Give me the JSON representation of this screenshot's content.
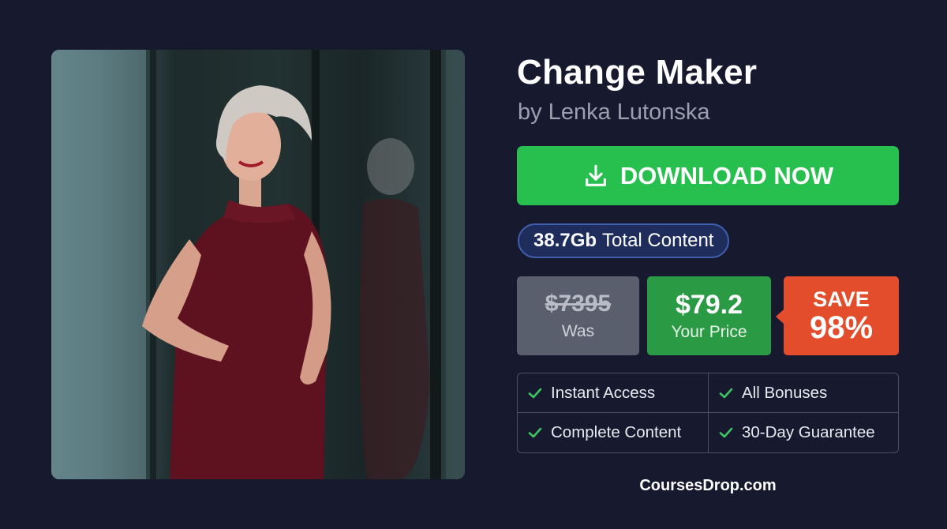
{
  "product": {
    "title": "Change Maker",
    "author": "by Lenka Lutonska"
  },
  "download": {
    "label": "DOWNLOAD NOW",
    "icon": "download-icon"
  },
  "content_size": {
    "value": "38.7Gb",
    "label": "Total Content"
  },
  "pricing": {
    "old_price": "$7395",
    "old_label": "Was",
    "price": "$79.2",
    "price_label": "Your Price",
    "save_label": "SAVE",
    "save_percent": "98%"
  },
  "features": [
    {
      "label": "Instant Access",
      "icon": "check-icon"
    },
    {
      "label": "All Bonuses",
      "icon": "check-icon"
    },
    {
      "label": "Complete Content",
      "icon": "check-icon"
    },
    {
      "label": "30-Day Guarantee",
      "icon": "check-icon"
    }
  ],
  "footer": {
    "site": "CoursesDrop.com"
  },
  "colors": {
    "background": "#171a2e",
    "download_button": "#27c04f",
    "price_box": "#2a9a44",
    "old_price_box": "#5a5f6e",
    "save_badge": "#e34d2c",
    "content_badge": "#1f2d5c",
    "check": "#3ec463"
  }
}
